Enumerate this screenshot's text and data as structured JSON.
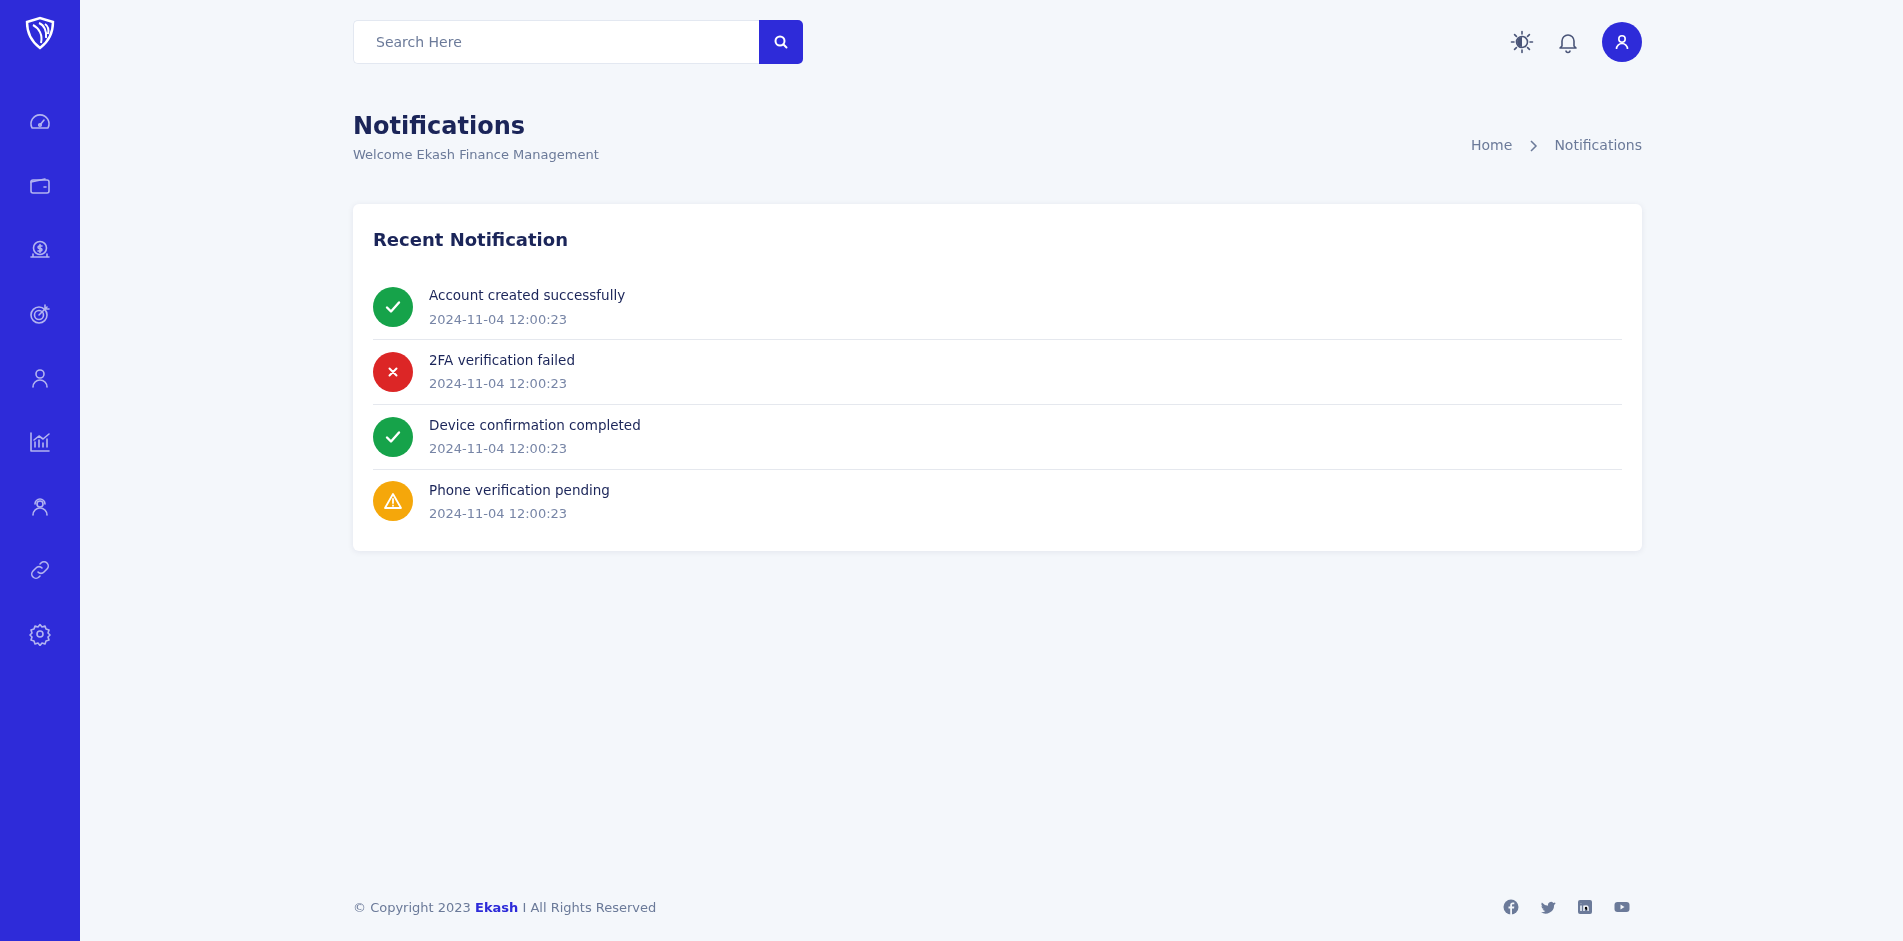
{
  "search": {
    "placeholder": "Search Here"
  },
  "page": {
    "title": "Notifications",
    "subtitle": "Welcome Ekash Finance Management"
  },
  "breadcrumb": [
    "Home",
    "Notifications"
  ],
  "card": {
    "title": "Recent Notification"
  },
  "notifications": [
    {
      "kind": "success",
      "title": "Account created successfully",
      "time": "2024-11-04 12:00:23"
    },
    {
      "kind": "error",
      "title": "2FA verification failed",
      "time": "2024-11-04 12:00:23"
    },
    {
      "kind": "success",
      "title": "Device confirmation completed",
      "time": "2024-11-04 12:00:23"
    },
    {
      "kind": "warning",
      "title": "Phone verification pending",
      "time": "2024-11-04 12:00:23"
    }
  ],
  "footer": {
    "copyright": "© Copyright 2023 **Ekash** I All Rights Reserved"
  }
}
